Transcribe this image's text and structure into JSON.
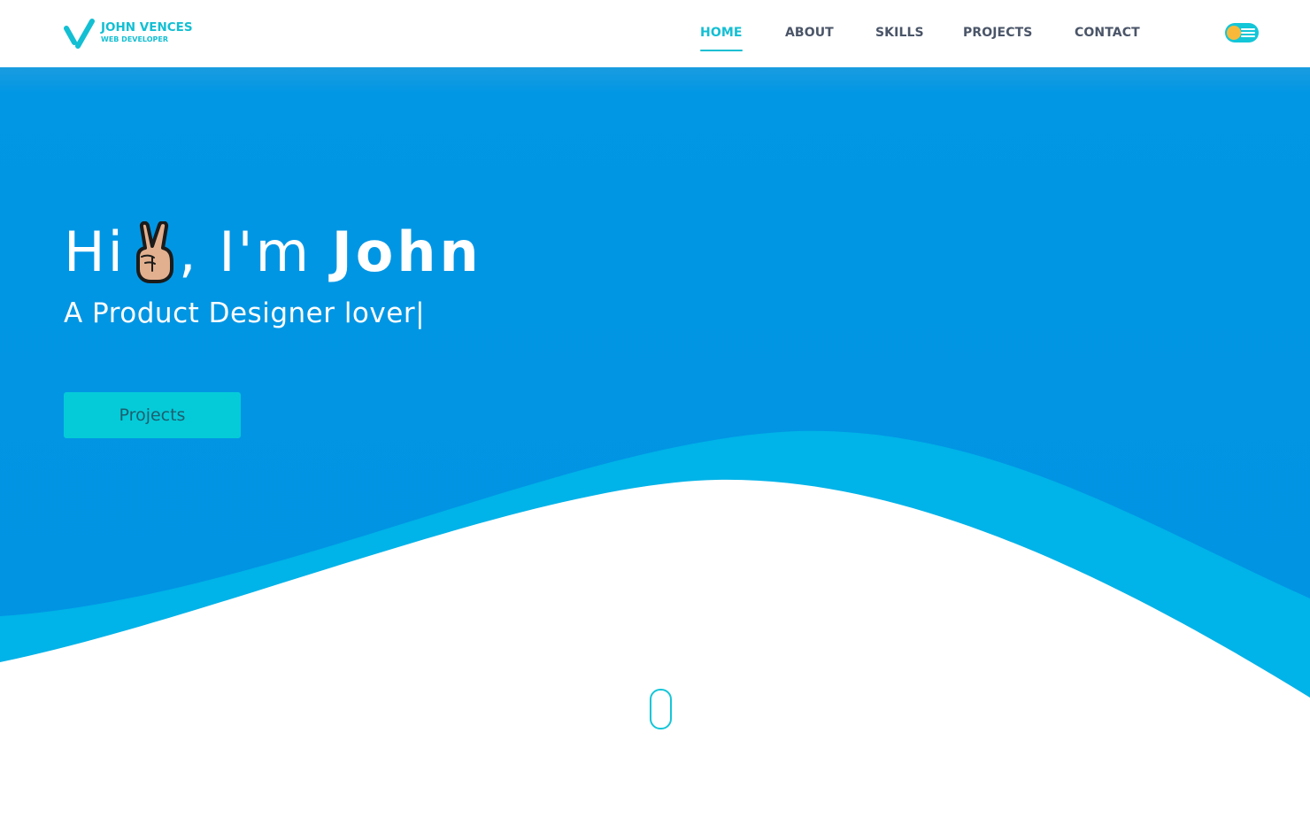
{
  "brand": {
    "name": "JOHN VENCES",
    "role": "WEB DEVELOPER",
    "logo_icon": "y-logo-mark"
  },
  "nav": {
    "items": [
      {
        "label": "HOME",
        "active": true
      },
      {
        "label": "ABOUT",
        "active": false
      },
      {
        "label": "SKILLS",
        "active": false
      },
      {
        "label": "PROJECTS",
        "active": false
      },
      {
        "label": "CONTACT",
        "active": false
      }
    ],
    "theme_toggle_icon": "theme-toggle-icon"
  },
  "hero": {
    "greeting": "Hi",
    "emoji_icon": "victory-hand-emoji",
    "intro": ", I'm ",
    "name": "John",
    "subtitle": "A Product Designer lover|",
    "button_label": "Projects"
  },
  "scroll_indicator_icon": "mouse-scroll-icon",
  "colors": {
    "accent": "#13bfd3",
    "hero_bg": "#0193e3",
    "wave_light": "#00b3e8",
    "button_bg": "#05cbd8",
    "toggle_knob": "#f8b93b",
    "nav_text": "#4a5568"
  }
}
